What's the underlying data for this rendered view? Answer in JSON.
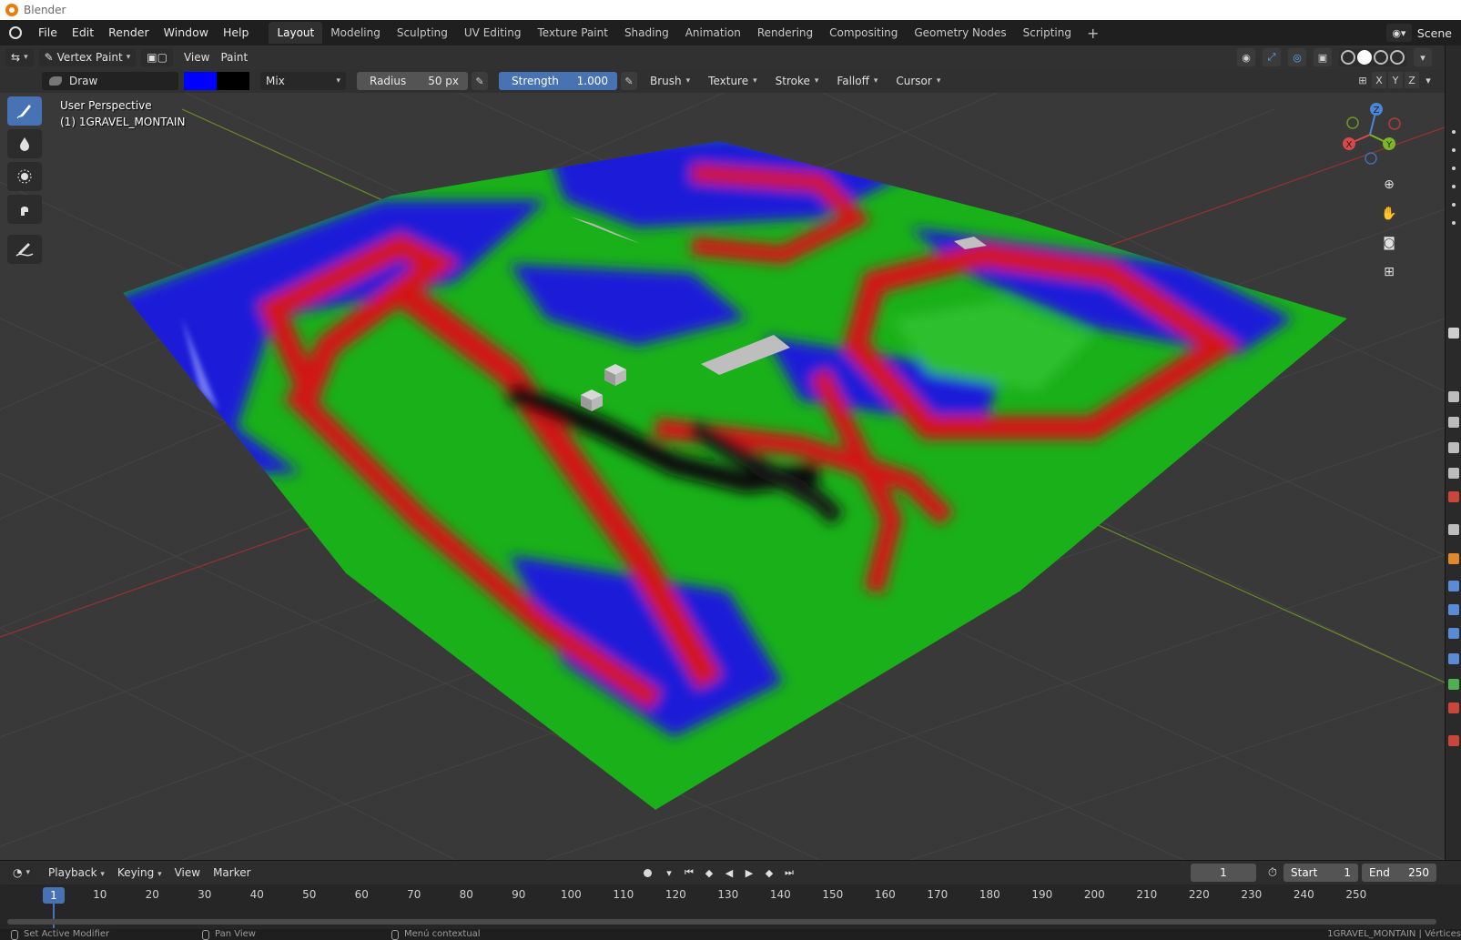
{
  "os_window": {
    "title": "Blender"
  },
  "menu": {
    "items": [
      "File",
      "Edit",
      "Render",
      "Window",
      "Help"
    ]
  },
  "workspaces": {
    "tabs": [
      "Layout",
      "Modeling",
      "Sculpting",
      "UV Editing",
      "Texture Paint",
      "Shading",
      "Animation",
      "Rendering",
      "Compositing",
      "Geometry Nodes",
      "Scripting"
    ],
    "active": "Layout",
    "add_icon": "plus-icon"
  },
  "scene": {
    "label": "Scene"
  },
  "viewport_header": {
    "mode": "Vertex Paint",
    "menus": [
      "View",
      "Paint"
    ]
  },
  "tool_settings": {
    "brush_name": "Draw",
    "primary_color": "#0000ff",
    "secondary_color": "#000000",
    "blend_mode": "Mix",
    "radius_label": "Radius",
    "radius_value": "50 px",
    "strength_label": "Strength",
    "strength_value": "1.000",
    "dropdowns": [
      "Brush",
      "Texture",
      "Stroke",
      "Falloff",
      "Cursor"
    ],
    "axes": [
      "X",
      "Y",
      "Z"
    ]
  },
  "overlay": {
    "view_name": "User Perspective",
    "object_name": "(1) 1GRAVEL_MONTAIN"
  },
  "gizmo": {
    "x": "X",
    "y": "Y",
    "z": "Z"
  },
  "toolbar": {
    "tools": [
      "draw-brush-icon",
      "blur-drop-icon",
      "average-icon",
      "smear-icon",
      "annotate-icon"
    ],
    "active": "draw-brush-icon"
  },
  "timeline": {
    "menus": [
      "Playback",
      "Keying",
      "View",
      "Marker"
    ],
    "current_frame": "1",
    "start_label": "Start",
    "start_value": "1",
    "end_label": "End",
    "end_value": "250",
    "ruler_marker": "1",
    "ruler_ticks": [
      "10",
      "20",
      "30",
      "40",
      "50",
      "60",
      "70",
      "80",
      "90",
      "100",
      "110",
      "120",
      "130",
      "140",
      "150",
      "160",
      "170",
      "180",
      "190",
      "200",
      "210",
      "220",
      "230",
      "240",
      "250"
    ]
  },
  "statusbar": {
    "left": "Set Active Modifier",
    "middle": "Pan View",
    "right": "Menú contextual",
    "info": "1GRAVEL_MONTAIN | Vértices"
  }
}
